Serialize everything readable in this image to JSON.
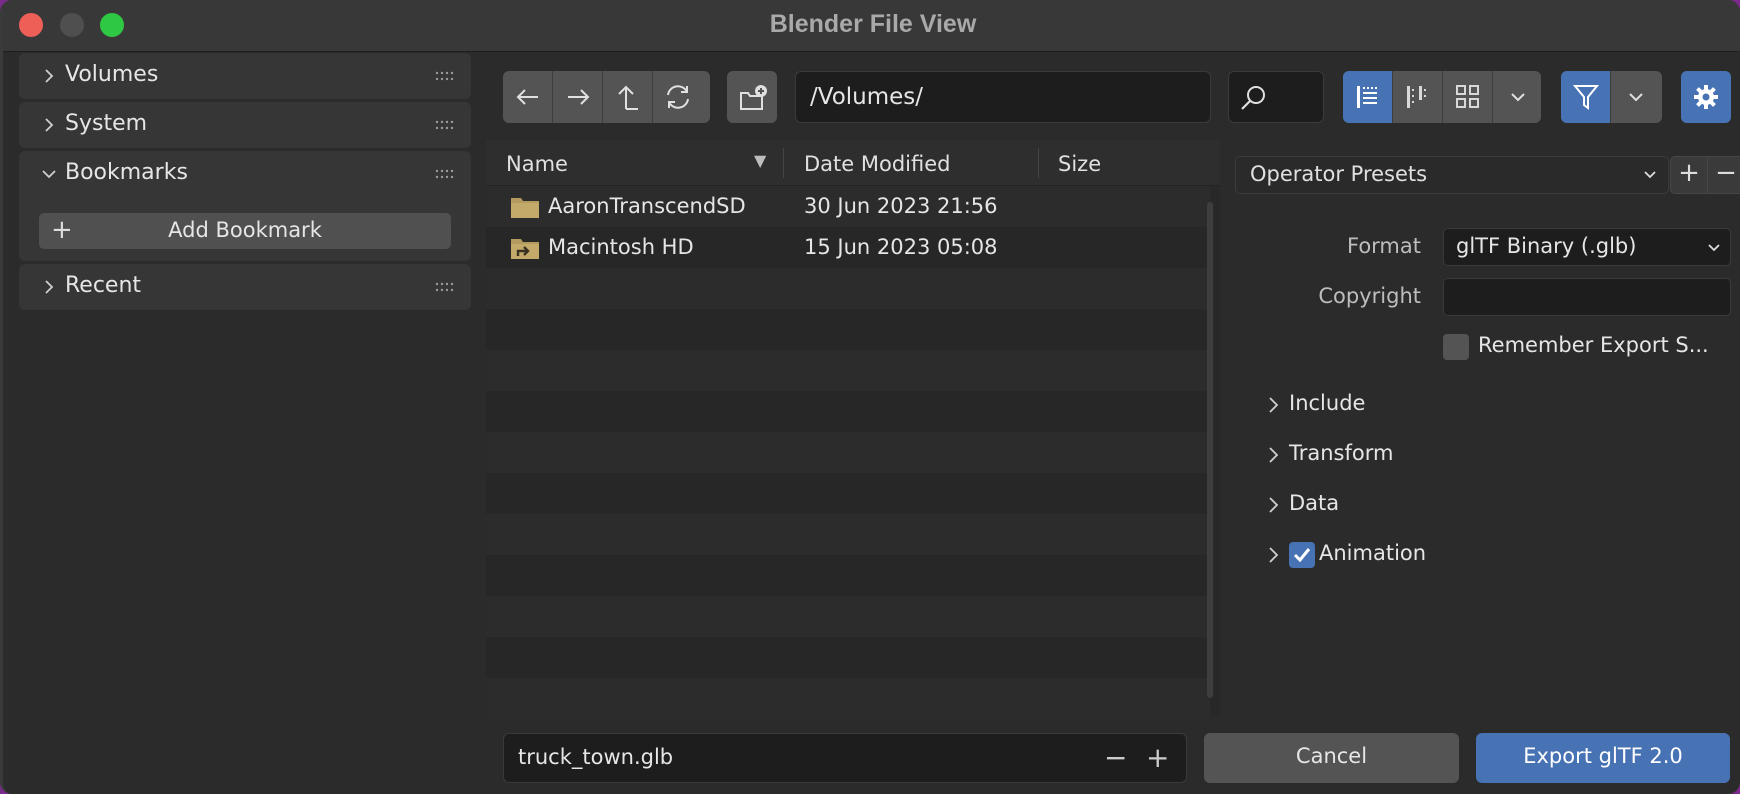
{
  "window": {
    "title": "Blender File View"
  },
  "sidebar": {
    "panels": [
      {
        "label": "Volumes",
        "expanded": false
      },
      {
        "label": "System",
        "expanded": false
      },
      {
        "label": "Bookmarks",
        "expanded": true,
        "add_label": "Add Bookmark"
      },
      {
        "label": "Recent",
        "expanded": false
      }
    ]
  },
  "toolbar": {
    "nav_icons": [
      "arrow-left-icon",
      "arrow-right-icon",
      "parent-directory-icon",
      "refresh-icon"
    ],
    "new_folder_icon": "new-folder-icon",
    "path": "/Volumes/",
    "search_icon": "search-icon",
    "display_modes": [
      "vertical-list-icon",
      "horizontal-list-icon",
      "thumbnails-icon"
    ],
    "active_display_mode": "vertical-list-icon",
    "filter_active": true,
    "accent": "#4772b3"
  },
  "filelist": {
    "columns": {
      "name": "Name",
      "date": "Date Modified",
      "size": "Size"
    },
    "sort_indicator": "▼",
    "rows": [
      {
        "name": "AaronTranscendSD",
        "date": "30 Jun 2023 21:56",
        "icon": "folder-icon"
      },
      {
        "name": "Macintosh HD",
        "date": "15 Jun 2023 05:08",
        "icon": "folder-link-icon"
      }
    ]
  },
  "properties": {
    "presets_label": "Operator Presets",
    "format_label": "Format",
    "format_value": "glTF Binary (.glb)",
    "copyright_label": "Copyright",
    "copyright_value": "",
    "remember_label": "Remember Export S...",
    "sections": [
      {
        "label": "Include"
      },
      {
        "label": "Transform"
      },
      {
        "label": "Data"
      },
      {
        "label": "Animation",
        "checked": true
      }
    ]
  },
  "bottom": {
    "filename": "truck_town.glb",
    "minus": "−",
    "plus": "+",
    "cancel_label": "Cancel",
    "export_label": "Export glTF 2.0"
  }
}
